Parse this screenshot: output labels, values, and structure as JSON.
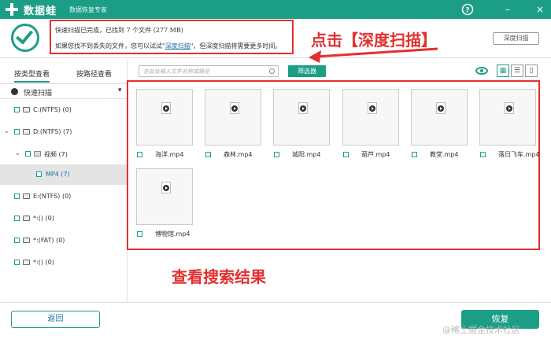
{
  "app": {
    "name": "数据蛙",
    "subtitle": "数据恢复专家"
  },
  "titlebar": {
    "help": "?",
    "minimize": "–",
    "close": "×"
  },
  "banner": {
    "line1": "快速扫描已完成，已找到 7 个文件 (277 MB)",
    "line2_prefix": "如果您找不到丢失的文件，您可以试试\"",
    "line2_link": "深度扫描",
    "line2_suffix": "\"，但深度扫描将需要更多时间。",
    "deep_scan_button": "深度扫描",
    "annotation": "点击【深度扫描】"
  },
  "sidebar": {
    "tab_type": "按类型查看",
    "tab_path": "按路径查看",
    "quick_scan": "快速扫描",
    "items": [
      {
        "label": "C:(NTFS) (0)"
      },
      {
        "label": "D:(NTFS) (7)"
      },
      {
        "label": "视频 (7)"
      },
      {
        "label": "MP4 (7)"
      },
      {
        "label": "E:(NTFS) (0)"
      },
      {
        "label": "*:() (0)"
      },
      {
        "label": "*:(FAT) (0)"
      },
      {
        "label": "*:() (0)"
      }
    ]
  },
  "toolbar": {
    "search_placeholder": "在此处输入文件名称或路径",
    "filter_button": "筛选器"
  },
  "files": [
    {
      "name": "海洋.mp4"
    },
    {
      "name": "森林.mp4"
    },
    {
      "name": "城阳.mp4"
    },
    {
      "name": "葫芦.mp4"
    },
    {
      "name": "教堂.mp4"
    },
    {
      "name": "落日飞车.mp4"
    },
    {
      "name": "博物馆.mp4"
    }
  ],
  "annotation_result": "查看搜索结果",
  "footer": {
    "back_button": "返回",
    "recover_button": "恢复",
    "watermark": "@稀土掘金技术社区"
  }
}
